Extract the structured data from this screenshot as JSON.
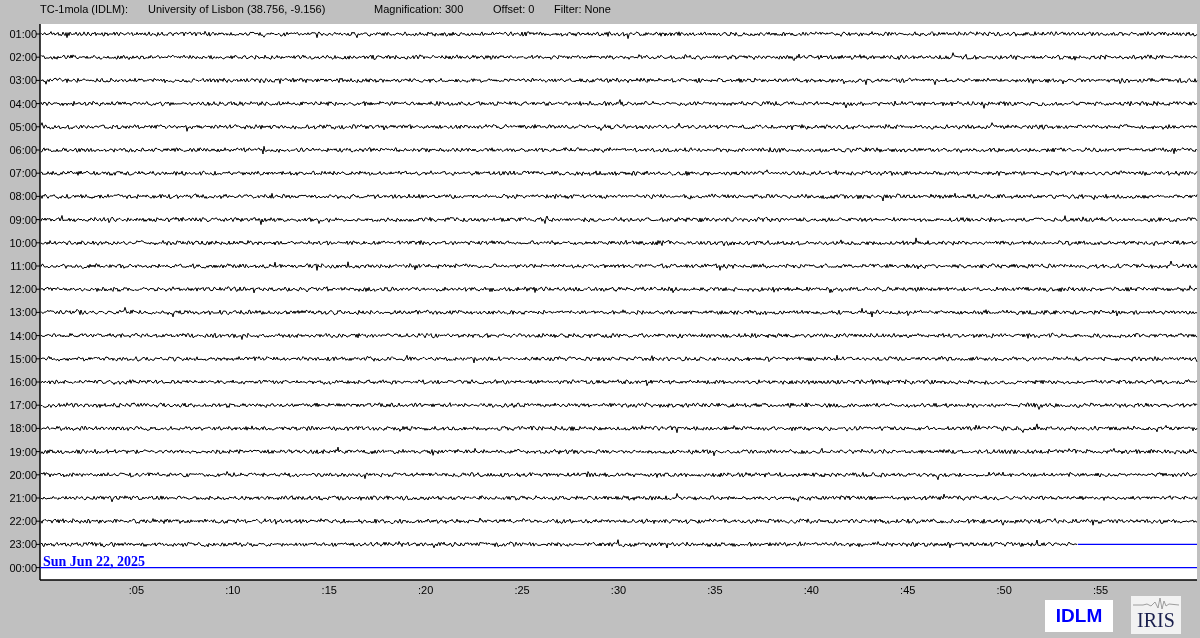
{
  "header": {
    "items": [
      "TC-1mola (IDLM):",
      "University of Lisbon (38.756, -9.156)",
      "Magnification: 300",
      "Offset: 0",
      "Filter: None"
    ]
  },
  "rows": [
    {
      "label": "01:00",
      "level": 1
    },
    {
      "label": "02:00",
      "level": 1
    },
    {
      "label": "03:00",
      "level": 1
    },
    {
      "label": "04:00",
      "level": 1
    },
    {
      "label": "05:00",
      "level": 1
    },
    {
      "label": "06:00",
      "level": 1
    },
    {
      "label": "07:00",
      "level": 1
    },
    {
      "label": "08:00",
      "level": 1
    },
    {
      "label": "09:00",
      "level": 1
    },
    {
      "label": "10:00",
      "level": 1
    },
    {
      "label": "11:00",
      "level": 1
    },
    {
      "label": "12:00",
      "level": 1
    },
    {
      "label": "13:00",
      "level": 1
    },
    {
      "label": "14:00",
      "level": 1
    },
    {
      "label": "15:00",
      "level": 1
    },
    {
      "label": "16:00",
      "level": 1
    },
    {
      "label": "17:00",
      "level": 1
    },
    {
      "label": "18:00",
      "level": 1
    },
    {
      "label": "19:00",
      "level": 1
    },
    {
      "label": "20:00",
      "level": 1
    },
    {
      "label": "21:00",
      "level": 1
    },
    {
      "label": "22:00",
      "level": 1
    },
    {
      "label": "23:00",
      "level": 0.897
    },
    {
      "label": "00:00"
    }
  ],
  "date_label": "Sun Jun 22, 2025",
  "x_ticks": [
    ":05",
    ":10",
    ":15",
    ":20",
    ":25",
    ":30",
    ":35",
    ":40",
    ":45",
    ":50",
    ":55"
  ],
  "logos": {
    "station": "IDLM",
    "network": "IRIS"
  }
}
